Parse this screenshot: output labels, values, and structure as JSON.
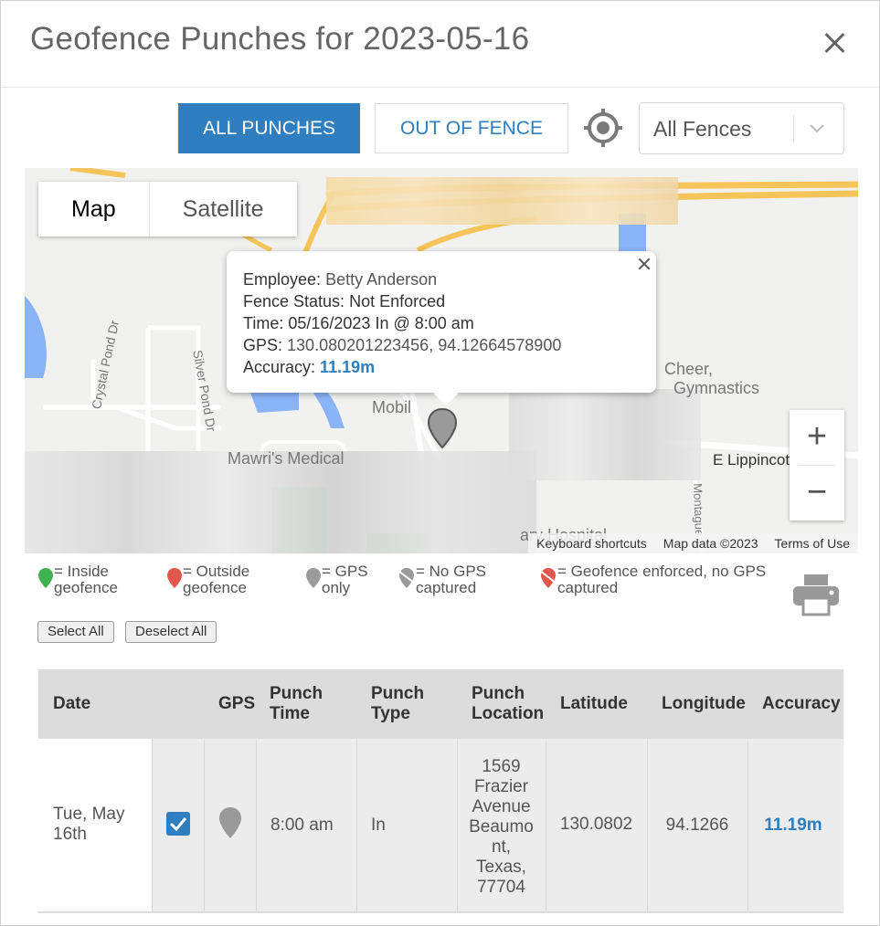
{
  "title": "Geofence Punches for 2023-05-16",
  "toolbar": {
    "all_punches": "ALL PUNCHES",
    "out_of_fence": "OUT OF FENCE",
    "fence_select": "All Fences"
  },
  "map": {
    "type_map": "Map",
    "type_satellite": "Satellite",
    "labels": {
      "crystal_pond": "Crystal Pond Dr",
      "silver_pond": "Silver Pond Dr",
      "mobil": "Mobil",
      "medical": "Mawri's Medical",
      "cheer": "Cheer,",
      "gymnastics": "Gymnastics",
      "lippincott": "E Lippincott",
      "montague": "Montague",
      "hospital": "ary Hospital"
    },
    "footer": {
      "shortcuts": "Keyboard shortcuts",
      "data": "Map data ©2023",
      "terms": "Terms of Use"
    },
    "zoom_in": "+",
    "zoom_out": "−",
    "infowindow": {
      "employee_key": "Employee:",
      "employee": "Betty Anderson",
      "status_key": "Fence Status:",
      "status": "Not Enforced",
      "time_key": "Time:",
      "time": "05/16/2023 In @ 8:00 am",
      "gps_key": "GPS:",
      "gps": "130.080201223456, 94.12664578900",
      "accuracy_key": "Accuracy:",
      "accuracy": "11.19m"
    }
  },
  "legend": {
    "inside": [
      "= Inside",
      "geofence"
    ],
    "outside": [
      "= Outside",
      "geofence"
    ],
    "gps_only": [
      "= GPS",
      "only"
    ],
    "no_gps": [
      "= No GPS",
      "captured"
    ],
    "enforced": [
      "= Geofence enforced, no GPS",
      "captured"
    ]
  },
  "actions": {
    "select_all": "Select All",
    "deselect_all": "Deselect All"
  },
  "table": {
    "headers": {
      "date": "Date",
      "gps": "GPS",
      "punch_time": [
        "Punch",
        "Time"
      ],
      "punch_type": [
        "Punch",
        "Type"
      ],
      "punch_location": [
        "Punch",
        "Location"
      ],
      "latitude": "Latitude",
      "longitude": "Longitude",
      "accuracy": "Accuracy"
    },
    "rows": [
      {
        "date": [
          "Tue, May",
          "16th"
        ],
        "checked": true,
        "punch_time": "8:00 am",
        "punch_type": "In",
        "location": [
          "1569",
          "Frazier",
          "Avenue",
          "Beaumo",
          "nt,",
          "Texas,",
          "77704"
        ],
        "latitude": "130.0802",
        "longitude": "94.1266",
        "accuracy": "11.19m"
      }
    ]
  },
  "colors": {
    "accent": "#2f7ebf",
    "inside": "#3fb34f",
    "outside": "#e2574c",
    "gps_only": "#9a9a9a"
  }
}
